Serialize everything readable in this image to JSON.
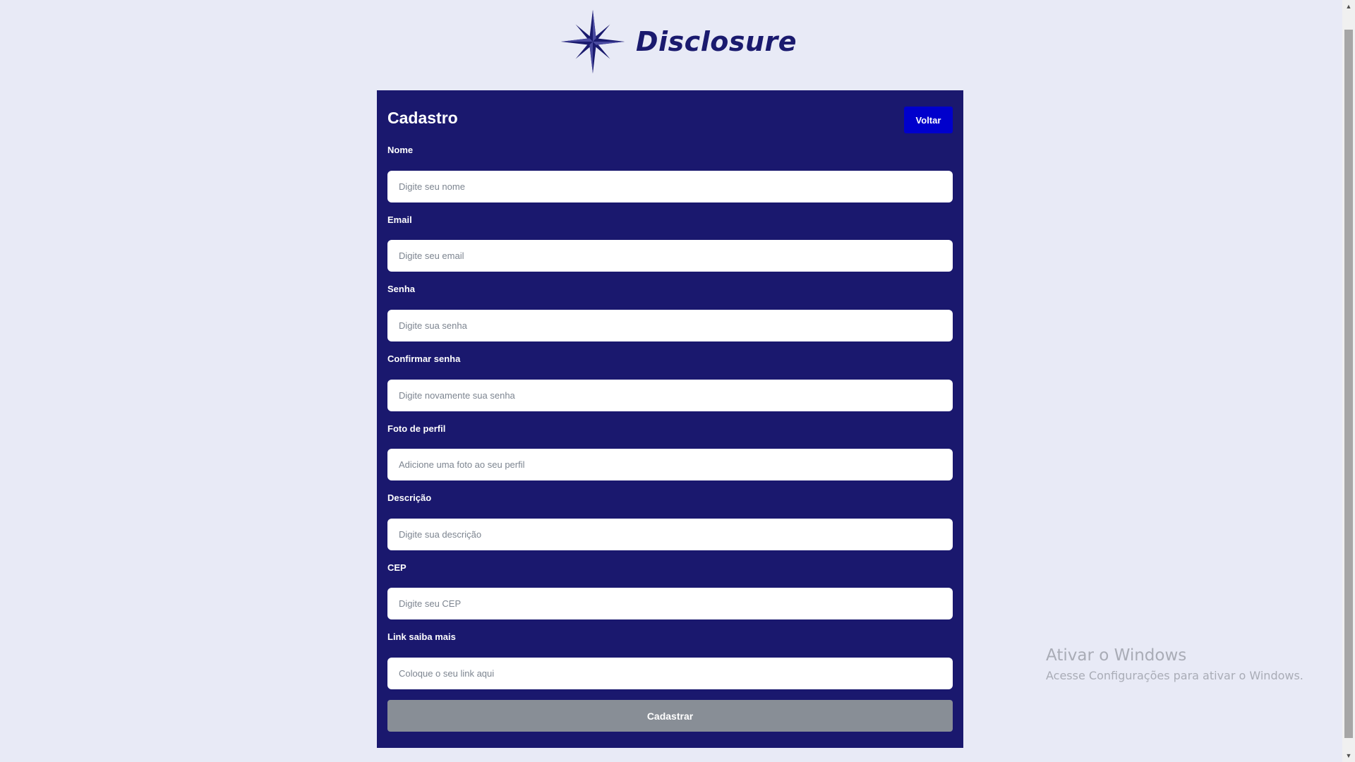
{
  "brand": {
    "name": "Disclosure",
    "logo_icon": "compass-star-icon",
    "color": "#1a1a6e"
  },
  "form": {
    "title": "Cadastro",
    "back_label": "Voltar",
    "submit_label": "Cadastrar",
    "background_color": "#1a186e",
    "back_button_color": "#0000cc",
    "submit_button_color": "#888e96",
    "fields": [
      {
        "label": "Nome",
        "placeholder": "Digite seu nome",
        "value": ""
      },
      {
        "label": "Email",
        "placeholder": "Digite seu email",
        "value": ""
      },
      {
        "label": "Senha",
        "placeholder": "Digite sua senha",
        "value": ""
      },
      {
        "label": "Confirmar senha",
        "placeholder": "Digite novamente sua senha",
        "value": ""
      },
      {
        "label": "Foto de perfil",
        "placeholder": "Adicione uma foto ao seu perfil",
        "value": ""
      },
      {
        "label": "Descrição",
        "placeholder": "Digite sua descrição",
        "value": ""
      },
      {
        "label": "CEP",
        "placeholder": "Digite seu CEP",
        "value": ""
      },
      {
        "label": "Link saiba mais",
        "placeholder": "Coloque o seu link aqui",
        "value": ""
      }
    ]
  },
  "watermark": {
    "title": "Ativar o Windows",
    "subtitle": "Acesse Configurações para ativar o Windows."
  },
  "page_background": "#e8eaf6"
}
